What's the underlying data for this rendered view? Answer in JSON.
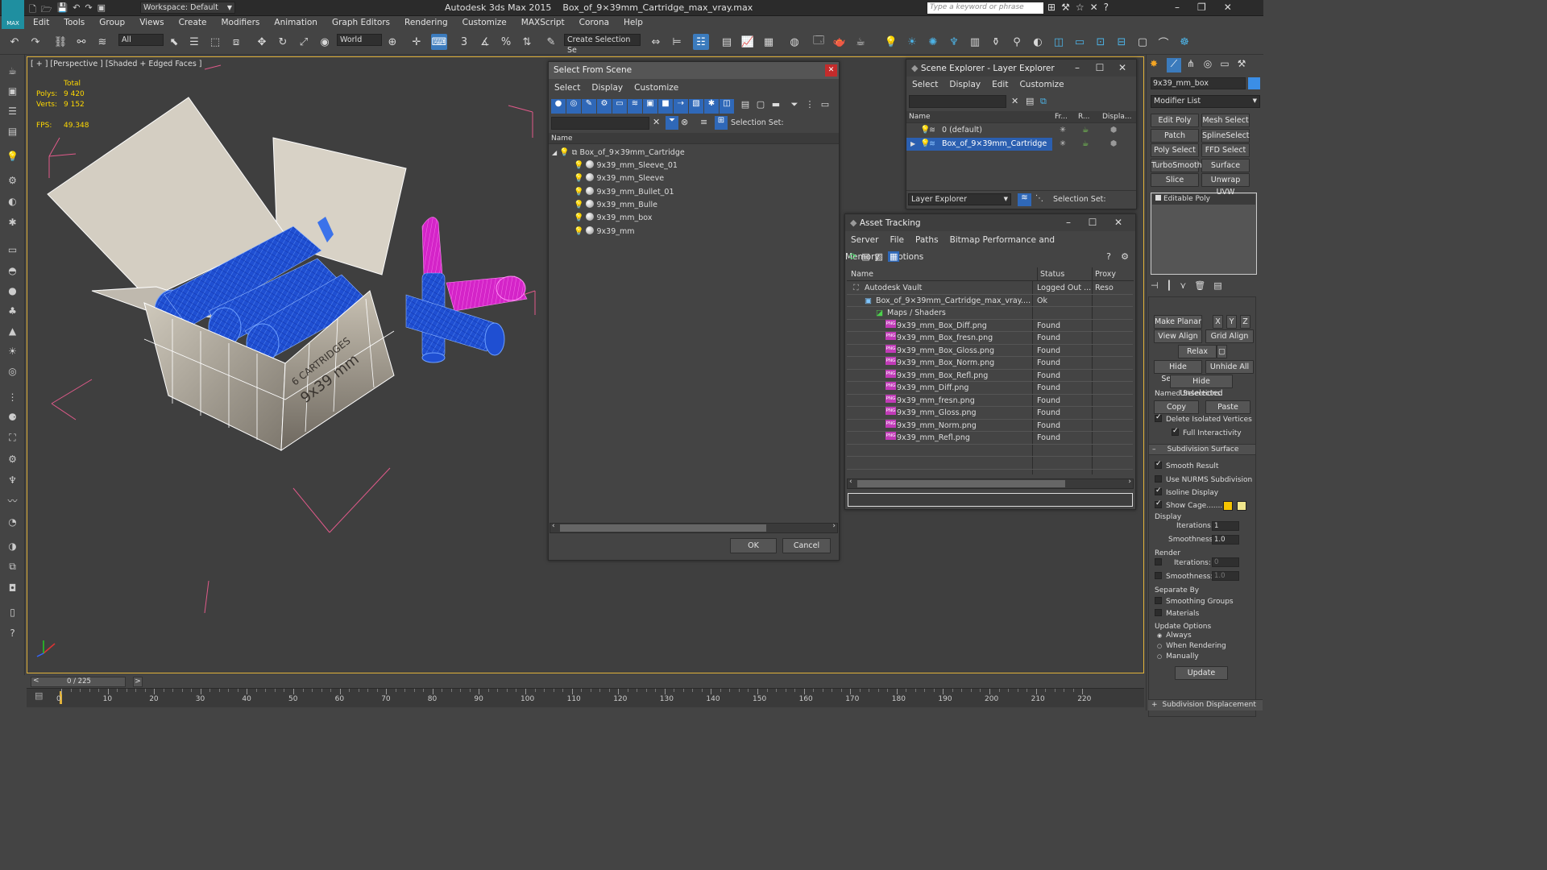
{
  "app": {
    "title": "Autodesk 3ds Max  2015",
    "file": "Box_of_9×39mm_Cartridge_max_vray.max",
    "workspace": "Workspace: Default",
    "search_placeholder": "Type a keyword or phrase",
    "logo_label": "MAX"
  },
  "menu": [
    "Edit",
    "Tools",
    "Group",
    "Views",
    "Create",
    "Modifiers",
    "Animation",
    "Graph Editors",
    "Rendering",
    "Customize",
    "MAXScript",
    "Corona",
    "Help"
  ],
  "toolbar": {
    "filter": "All",
    "coord": "World",
    "selection_set": "Create Selection Se",
    "snap_labels": [
      "3",
      "n"
    ]
  },
  "viewport": {
    "label": "[ + ] [Perspective ] [Shaded + Edged Faces ]",
    "stats_header": "Total",
    "polys_label": "Polys:",
    "polys": "9 420",
    "verts_label": "Verts:",
    "verts": "9 152",
    "fps_label": "FPS:",
    "fps": "49.348",
    "box_text1": "6 CARTRIDGES",
    "box_text2": "9x39 mm"
  },
  "timeline": {
    "frame": "0 / 225",
    "ticks": [
      "0",
      "10",
      "20",
      "30",
      "40",
      "50",
      "60",
      "70",
      "80",
      "90",
      "100",
      "110",
      "120",
      "130",
      "140",
      "150",
      "160",
      "170",
      "180",
      "190",
      "200",
      "210",
      "220"
    ]
  },
  "select_from_scene": {
    "title": "Select From Scene",
    "menu": [
      "Select",
      "Display",
      "Customize"
    ],
    "selection_set": "Selection Set:",
    "col_name": "Name",
    "root": "Box_of_9×39mm_Cartridge",
    "items": [
      "9x39_mm_Sleeve_01",
      "9x39_mm_Sleeve",
      "9x39_mm_Bullet_01",
      "9x39_mm_Bulle",
      "9x39_mm_box",
      "9x39_mm"
    ],
    "ok": "OK",
    "cancel": "Cancel"
  },
  "scene_explorer": {
    "title": "Scene Explorer - Layer Explorer",
    "menu": [
      "Select",
      "Display",
      "Edit",
      "Customize"
    ],
    "cols": [
      "Name",
      "Fr...",
      "R...",
      "Displa..."
    ],
    "layers": [
      "0 (default)",
      "Box_of_9×39mm_Cartridge"
    ],
    "footer_dropdown": "Layer Explorer",
    "selection_set": "Selection Set:"
  },
  "asset_tracking": {
    "title": "Asset Tracking",
    "menu": [
      "Server",
      "File",
      "Paths",
      "Bitmap Performance and Memory",
      "Options"
    ],
    "cols": [
      "Name",
      "Status",
      "Proxy Reso"
    ],
    "rows": [
      {
        "name": "Autodesk Vault",
        "status": "Logged Out ..."
      },
      {
        "name": "Box_of_9×39mm_Cartridge_max_vray....",
        "status": "Ok"
      },
      {
        "name": "Maps / Shaders",
        "status": ""
      },
      {
        "name": "9x39_mm_Box_Diff.png",
        "status": "Found"
      },
      {
        "name": "9x39_mm_Box_fresn.png",
        "status": "Found"
      },
      {
        "name": "9x39_mm_Box_Gloss.png",
        "status": "Found"
      },
      {
        "name": "9x39_mm_Box_Norm.png",
        "status": "Found"
      },
      {
        "name": "9x39_mm_Box_Refl.png",
        "status": "Found"
      },
      {
        "name": "9x39_mm_Diff.png",
        "status": "Found"
      },
      {
        "name": "9x39_mm_fresn.png",
        "status": "Found"
      },
      {
        "name": "9x39_mm_Gloss.png",
        "status": "Found"
      },
      {
        "name": "9x39_mm_Norm.png",
        "status": "Found"
      },
      {
        "name": "9x39_mm_Refl.png",
        "status": "Found"
      }
    ],
    "png_tag": "PNG"
  },
  "command_panel": {
    "object_name": "9x39_mm_box",
    "modifier_list": "Modifier List",
    "mod_buttons": [
      "Edit Poly",
      "Mesh Select",
      "Patch Select",
      "SplineSelect",
      "Poly Select",
      "FFD Select",
      "TurboSmooth",
      "Surface Select",
      "Slice",
      "Unwrap UVW"
    ],
    "stack_item": "Editable Poly",
    "make_planar": "Make Planar",
    "x": "X",
    "y": "Y",
    "z": "Z",
    "view_align": "View Align",
    "grid_align": "Grid Align",
    "relax": "Relax",
    "hide_selected": "Hide Selected",
    "unhide_all": "Unhide All",
    "hide_unselected": "Hide Unselected",
    "named_selections": "Named Selections:",
    "copy": "Copy",
    "paste": "Paste",
    "delete_isolated": "Delete Isolated Vertices",
    "full_interactivity": "Full Interactivity",
    "subdiv_surface": "Subdivision Surface",
    "smooth_result": "Smooth Result",
    "use_nurms": "Use NURMS Subdivision",
    "isoline": "Isoline Display",
    "show_cage": "Show Cage.......",
    "display": "Display",
    "iterations": "Iterations:",
    "iter_val": "1",
    "smoothness": "Smoothness:",
    "smooth_val": "1.0",
    "render": "Render",
    "r_iter_val": "0",
    "r_smooth_val": "1.0",
    "separate_by": "Separate By",
    "smoothing_groups": "Smoothing Groups",
    "materials": "Materials",
    "update_options": "Update Options",
    "always": "Always",
    "when_rendering": "When Rendering",
    "manually": "Manually",
    "update": "Update",
    "subdiv_displacement": "Subdivision Displacement"
  },
  "colors": {
    "accent": "#3b7bbd",
    "viewport_border": "#e1b23a",
    "wire_blue": "#2f6fe8",
    "wire_magenta": "#e02ad0",
    "cage_yellow": "#f5c400"
  }
}
